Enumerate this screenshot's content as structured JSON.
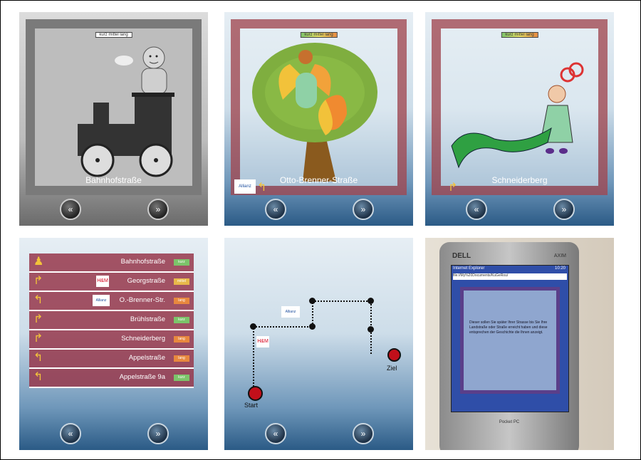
{
  "panels": {
    "p1": {
      "pill": "kurz mittel lang",
      "caption": "Bahnhofstraße"
    },
    "p2": {
      "pill": "kurz mittel lang",
      "caption": "Otto-Brenner-Straße",
      "sponsor": "Allianz"
    },
    "p3": {
      "pill": "kurz mittel lang",
      "caption": "Schneiderberg"
    },
    "p4": {
      "rows": [
        {
          "street": "Bahnhofstraße",
          "badge": "kurz",
          "badge_color": "#7cc46a"
        },
        {
          "street": "Georgstraße",
          "badge": "mittel",
          "badge_color": "#e8b84a"
        },
        {
          "street": "O.-Brenner-Str.",
          "badge": "lang",
          "badge_color": "#e8883e"
        },
        {
          "street": "Brühlstraße",
          "badge": "kurz",
          "badge_color": "#7cc46a"
        },
        {
          "street": "Schneiderberg",
          "badge": "lang",
          "badge_color": "#e8883e"
        },
        {
          "street": "Appelstraße",
          "badge": "lang",
          "badge_color": "#e8883e"
        },
        {
          "street": "Appelstraße 9a",
          "badge": "kurz",
          "badge_color": "#7cc46a"
        }
      ],
      "sponsors": [
        "H&M",
        "Allianz"
      ]
    },
    "p5": {
      "start": "Start",
      "goal": "Ziel",
      "sponsors": [
        "Allianz",
        "H&M"
      ]
    },
    "p6": {
      "brand": "DELL",
      "brand_right": "AXIM",
      "title": "Internet Explorer",
      "time": "10:20",
      "address": "file://My%20Documents/KuGeRou/",
      "body_text": "Dieser sollen Sie später Ihrer Strasse bis Sie Ihre Landstraße oder Straße erreicht haben und diese entsprechen der Geschichte die Ihnen anzeigt.",
      "device_label": "Pocket PC"
    }
  },
  "nav": {
    "prev": "«",
    "next": "»"
  }
}
